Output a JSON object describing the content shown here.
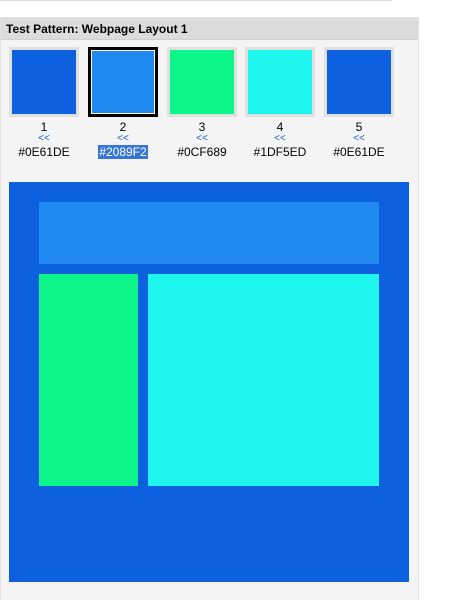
{
  "title": "Test Pattern: Webpage Layout 1",
  "swatches": [
    {
      "number": "1",
      "back": "<<",
      "hex": "#0E61DE",
      "color": "#0E61DE",
      "selected": false
    },
    {
      "number": "2",
      "back": "<<",
      "hex": "#2089F2",
      "color": "#2089F2",
      "selected": true
    },
    {
      "number": "3",
      "back": "<<",
      "hex": "#0CF689",
      "color": "#0CF689",
      "selected": false
    },
    {
      "number": "4",
      "back": "<<",
      "hex": "#1DF5ED",
      "color": "#1DF5ED",
      "selected": false
    },
    {
      "number": "5",
      "back": "<<",
      "hex": "#0E61DE",
      "color": "#0E61DE",
      "selected": false
    }
  ],
  "layout_colors": {
    "background": "#0E61DE",
    "header": "#2089F2",
    "sidebar": "#0CF689",
    "content": "#1DF5ED"
  }
}
